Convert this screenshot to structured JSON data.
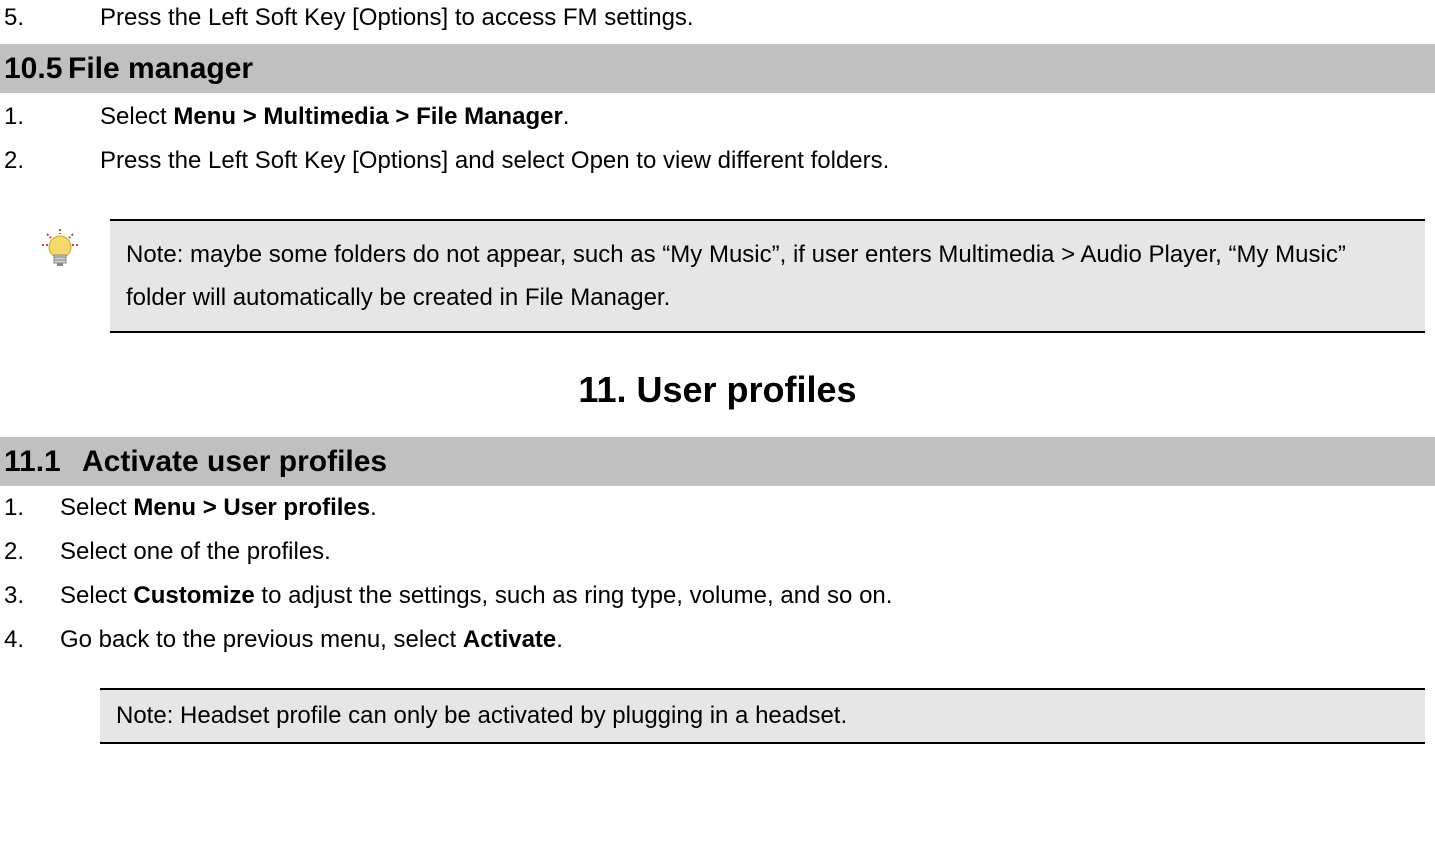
{
  "top_item": {
    "num": "5.",
    "text": "Press the Left Soft Key [Options] to access FM settings."
  },
  "section_10_5": {
    "num": "10.5",
    "title": "File manager",
    "items": [
      {
        "num": "1.",
        "prefix": "Select ",
        "bold": "Menu > Multimedia > File Manager",
        "suffix": "."
      },
      {
        "num": "2.",
        "text": "Press the Left Soft Key [Options] and select Open to view different folders."
      }
    ]
  },
  "note1": "Note: maybe some folders do not appear, such as “My Music”, if user enters Multimedia > Audio Player, “My Music” folder will automatically be created in File Manager.",
  "chapter_11": "11. User profiles",
  "section_11_1": {
    "num": "11.1",
    "title": "Activate user profiles",
    "items": [
      {
        "num": "1.",
        "prefix": "Select ",
        "bold": "Menu > User profiles",
        "suffix": "."
      },
      {
        "num": "2.",
        "text": "Select one of the profiles."
      },
      {
        "num": "3.",
        "prefix": "Select ",
        "bold": "Customize",
        "suffix": " to adjust the settings, such as ring type, volume, and so on."
      },
      {
        "num": "4.",
        "prefix": "Go back to the previous menu, select ",
        "bold": "Activate",
        "suffix": "."
      }
    ]
  },
  "note2": "Note: Headset profile can only be activated by plugging in a headset."
}
